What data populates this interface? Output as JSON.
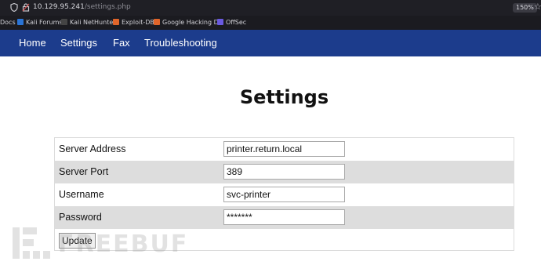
{
  "browser": {
    "url_host": "10.129.95.241",
    "url_path": "/settings.php",
    "zoom": "150%",
    "bookmarks": [
      {
        "label": "Docs",
        "color": "#4a6fd1"
      },
      {
        "label": "Kali Forums",
        "color": "#2a74d6"
      },
      {
        "label": "Kali NetHunter",
        "color": "#444444"
      },
      {
        "label": "Exploit-DB",
        "color": "#e0652a"
      },
      {
        "label": "Google Hacking DB",
        "color": "#e0652a"
      },
      {
        "label": "OffSec",
        "color": "#6a5ae0"
      }
    ]
  },
  "nav": {
    "items": [
      "Home",
      "Settings",
      "Fax",
      "Troubleshooting"
    ],
    "color": "#1c3c8c"
  },
  "page": {
    "title": "Settings"
  },
  "form": {
    "fields": [
      {
        "label": "Server Address",
        "value": "printer.return.local"
      },
      {
        "label": "Server Port",
        "value": "389"
      },
      {
        "label": "Username",
        "value": "svc-printer"
      },
      {
        "label": "Password",
        "value": "*******"
      }
    ],
    "submit_label": "Update"
  },
  "watermark": {
    "text": "FREEBUF"
  }
}
